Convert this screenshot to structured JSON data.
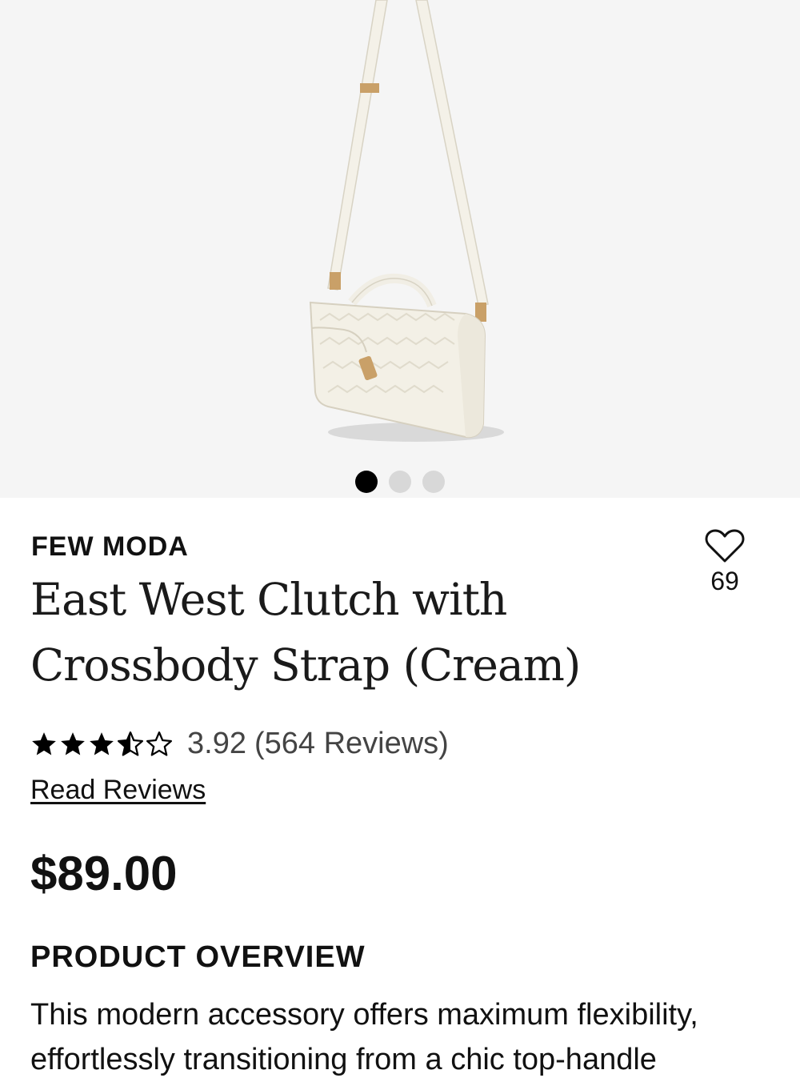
{
  "gallery": {
    "image_alt": "East West Clutch with Crossbody Strap (Cream)",
    "image_count": 3,
    "active_index": 0
  },
  "product": {
    "brand": "FEW MODA",
    "title": "East West Clutch with Crossbody Strap (Cream)",
    "favorites_count": "69",
    "rating_value": "3.92",
    "review_count_text": "(564 Reviews)",
    "stars": [
      "full",
      "full",
      "full",
      "half",
      "empty"
    ],
    "read_reviews_label": "Read Reviews",
    "price": "$89.00"
  },
  "overview": {
    "heading": "PRODUCT OVERVIEW",
    "body": "This modern accessory offers maximum flexibility, effortlessly transitioning from a chic top-handle"
  },
  "colors": {
    "gallery_bg": "#f5f5f5",
    "dot_active": "#000000",
    "dot_inactive": "#d8d8d8",
    "bag": "#f3f0e6",
    "hardware": "#c9a068"
  },
  "icons": {
    "favorite": "heart-outline-icon",
    "star_full": "star-filled-icon",
    "star_half": "star-half-icon",
    "star_empty": "star-outline-icon"
  }
}
